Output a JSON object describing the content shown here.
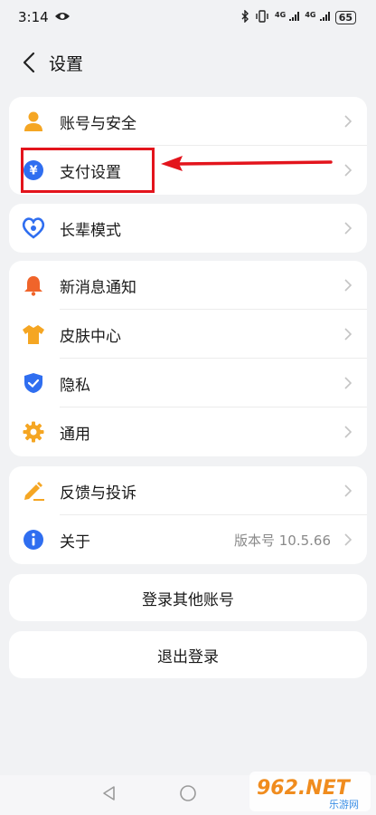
{
  "status": {
    "time": "3:14",
    "network": "4G",
    "battery": "65"
  },
  "header": {
    "title": "设置"
  },
  "groups": {
    "account": [
      {
        "label": "账号与安全",
        "icon": "person-icon",
        "color": "#f5a623"
      },
      {
        "label": "支付设置",
        "icon": "yuan-icon",
        "color": "#2f6ef0"
      }
    ],
    "elder": [
      {
        "label": "长辈模式",
        "icon": "heart-icon",
        "color": "#2f6ef0"
      }
    ],
    "prefs": [
      {
        "label": "新消息通知",
        "icon": "bell-icon",
        "color": "#f0642a"
      },
      {
        "label": "皮肤中心",
        "icon": "tshirt-icon",
        "color": "#f5a623"
      },
      {
        "label": "隐私",
        "icon": "shield-icon",
        "color": "#2f6ef0"
      },
      {
        "label": "通用",
        "icon": "gear-icon",
        "color": "#f5a623"
      }
    ],
    "support": [
      {
        "label": "反馈与投诉",
        "icon": "pencil-icon",
        "color": "#f5a623"
      },
      {
        "label": "关于",
        "icon": "info-icon",
        "color": "#2f6ef0",
        "value": "版本号 10.5.66"
      }
    ]
  },
  "actions": {
    "switch_account": "登录其他账号",
    "logout": "退出登录"
  },
  "annotation": {
    "color": "#e3141c"
  },
  "watermark": {
    "text": "962.NET",
    "sub": "乐游网"
  }
}
